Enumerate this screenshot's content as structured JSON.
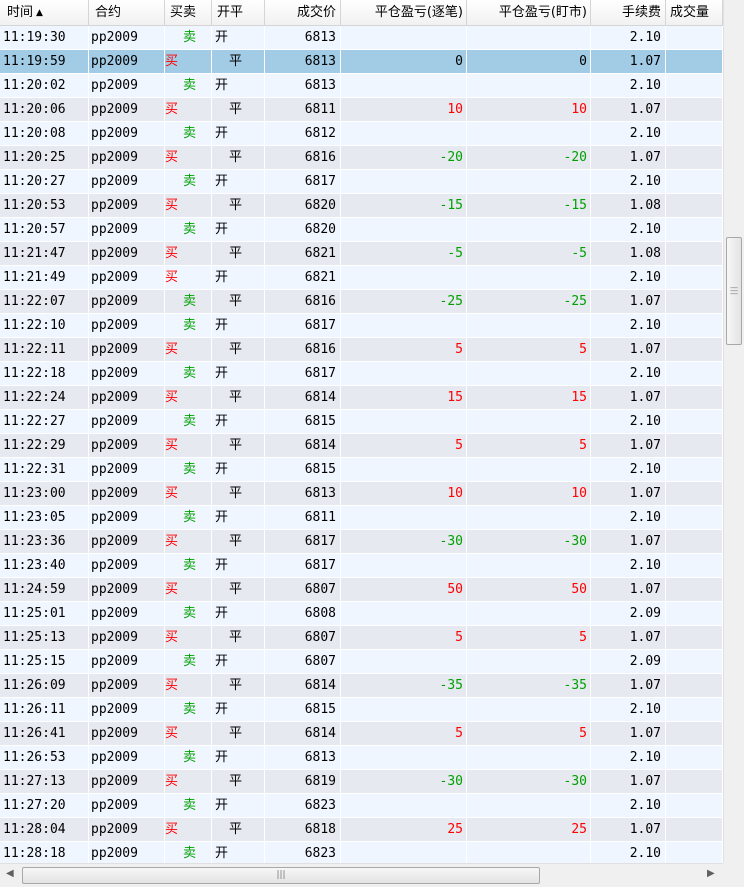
{
  "columns": [
    {
      "label": "时间",
      "sort": "▲"
    },
    {
      "label": "合约"
    },
    {
      "label": "买卖"
    },
    {
      "label": "开平"
    },
    {
      "label": "成交价"
    },
    {
      "label": "平仓盈亏(逐笔)"
    },
    {
      "label": "平仓盈亏(盯市)"
    },
    {
      "label": "手续费"
    },
    {
      "label": "成交量"
    }
  ],
  "selected_row": 1,
  "colors": {
    "buy": "#ff0000",
    "sell": "#00a000",
    "profit": "#ff0000",
    "loss": "#00a000",
    "selection": "#a2cbe6"
  },
  "icons": {
    "sort": "sort-ascending-icon",
    "scroll_left": "arrow-left-icon",
    "scroll_right": "arrow-right-icon"
  },
  "rows": [
    {
      "time": "11:19:30",
      "contract": "pp2009",
      "side": "卖",
      "oc": "开",
      "price": "6813",
      "pnl_trade": "",
      "pnl_mark": "",
      "fee": "2.10"
    },
    {
      "time": "11:19:59",
      "contract": "pp2009",
      "side": "买",
      "oc": "平",
      "price": "6813",
      "pnl_trade": "0",
      "pnl_mark": "0",
      "fee": "1.07"
    },
    {
      "time": "11:20:02",
      "contract": "pp2009",
      "side": "卖",
      "oc": "开",
      "price": "6813",
      "pnl_trade": "",
      "pnl_mark": "",
      "fee": "2.10"
    },
    {
      "time": "11:20:06",
      "contract": "pp2009",
      "side": "买",
      "oc": "平",
      "price": "6811",
      "pnl_trade": "10",
      "pnl_mark": "10",
      "fee": "1.07"
    },
    {
      "time": "11:20:08",
      "contract": "pp2009",
      "side": "卖",
      "oc": "开",
      "price": "6812",
      "pnl_trade": "",
      "pnl_mark": "",
      "fee": "2.10"
    },
    {
      "time": "11:20:25",
      "contract": "pp2009",
      "side": "买",
      "oc": "平",
      "price": "6816",
      "pnl_trade": "-20",
      "pnl_mark": "-20",
      "fee": "1.07"
    },
    {
      "time": "11:20:27",
      "contract": "pp2009",
      "side": "卖",
      "oc": "开",
      "price": "6817",
      "pnl_trade": "",
      "pnl_mark": "",
      "fee": "2.10"
    },
    {
      "time": "11:20:53",
      "contract": "pp2009",
      "side": "买",
      "oc": "平",
      "price": "6820",
      "pnl_trade": "-15",
      "pnl_mark": "-15",
      "fee": "1.08"
    },
    {
      "time": "11:20:57",
      "contract": "pp2009",
      "side": "卖",
      "oc": "开",
      "price": "6820",
      "pnl_trade": "",
      "pnl_mark": "",
      "fee": "2.10"
    },
    {
      "time": "11:21:47",
      "contract": "pp2009",
      "side": "买",
      "oc": "平",
      "price": "6821",
      "pnl_trade": "-5",
      "pnl_mark": "-5",
      "fee": "1.08"
    },
    {
      "time": "11:21:49",
      "contract": "pp2009",
      "side": "买",
      "oc": "开",
      "price": "6821",
      "pnl_trade": "",
      "pnl_mark": "",
      "fee": "2.10"
    },
    {
      "time": "11:22:07",
      "contract": "pp2009",
      "side": "卖",
      "oc": "平",
      "price": "6816",
      "pnl_trade": "-25",
      "pnl_mark": "-25",
      "fee": "1.07"
    },
    {
      "time": "11:22:10",
      "contract": "pp2009",
      "side": "卖",
      "oc": "开",
      "price": "6817",
      "pnl_trade": "",
      "pnl_mark": "",
      "fee": "2.10"
    },
    {
      "time": "11:22:11",
      "contract": "pp2009",
      "side": "买",
      "oc": "平",
      "price": "6816",
      "pnl_trade": "5",
      "pnl_mark": "5",
      "fee": "1.07"
    },
    {
      "time": "11:22:18",
      "contract": "pp2009",
      "side": "卖",
      "oc": "开",
      "price": "6817",
      "pnl_trade": "",
      "pnl_mark": "",
      "fee": "2.10"
    },
    {
      "time": "11:22:24",
      "contract": "pp2009",
      "side": "买",
      "oc": "平",
      "price": "6814",
      "pnl_trade": "15",
      "pnl_mark": "15",
      "fee": "1.07"
    },
    {
      "time": "11:22:27",
      "contract": "pp2009",
      "side": "卖",
      "oc": "开",
      "price": "6815",
      "pnl_trade": "",
      "pnl_mark": "",
      "fee": "2.10"
    },
    {
      "time": "11:22:29",
      "contract": "pp2009",
      "side": "买",
      "oc": "平",
      "price": "6814",
      "pnl_trade": "5",
      "pnl_mark": "5",
      "fee": "1.07"
    },
    {
      "time": "11:22:31",
      "contract": "pp2009",
      "side": "卖",
      "oc": "开",
      "price": "6815",
      "pnl_trade": "",
      "pnl_mark": "",
      "fee": "2.10"
    },
    {
      "time": "11:23:00",
      "contract": "pp2009",
      "side": "买",
      "oc": "平",
      "price": "6813",
      "pnl_trade": "10",
      "pnl_mark": "10",
      "fee": "1.07"
    },
    {
      "time": "11:23:05",
      "contract": "pp2009",
      "side": "卖",
      "oc": "开",
      "price": "6811",
      "pnl_trade": "",
      "pnl_mark": "",
      "fee": "2.10"
    },
    {
      "time": "11:23:36",
      "contract": "pp2009",
      "side": "买",
      "oc": "平",
      "price": "6817",
      "pnl_trade": "-30",
      "pnl_mark": "-30",
      "fee": "1.07"
    },
    {
      "time": "11:23:40",
      "contract": "pp2009",
      "side": "卖",
      "oc": "开",
      "price": "6817",
      "pnl_trade": "",
      "pnl_mark": "",
      "fee": "2.10"
    },
    {
      "time": "11:24:59",
      "contract": "pp2009",
      "side": "买",
      "oc": "平",
      "price": "6807",
      "pnl_trade": "50",
      "pnl_mark": "50",
      "fee": "1.07"
    },
    {
      "time": "11:25:01",
      "contract": "pp2009",
      "side": "卖",
      "oc": "开",
      "price": "6808",
      "pnl_trade": "",
      "pnl_mark": "",
      "fee": "2.09"
    },
    {
      "time": "11:25:13",
      "contract": "pp2009",
      "side": "买",
      "oc": "平",
      "price": "6807",
      "pnl_trade": "5",
      "pnl_mark": "5",
      "fee": "1.07"
    },
    {
      "time": "11:25:15",
      "contract": "pp2009",
      "side": "卖",
      "oc": "开",
      "price": "6807",
      "pnl_trade": "",
      "pnl_mark": "",
      "fee": "2.09"
    },
    {
      "time": "11:26:09",
      "contract": "pp2009",
      "side": "买",
      "oc": "平",
      "price": "6814",
      "pnl_trade": "-35",
      "pnl_mark": "-35",
      "fee": "1.07"
    },
    {
      "time": "11:26:11",
      "contract": "pp2009",
      "side": "卖",
      "oc": "开",
      "price": "6815",
      "pnl_trade": "",
      "pnl_mark": "",
      "fee": "2.10"
    },
    {
      "time": "11:26:41",
      "contract": "pp2009",
      "side": "买",
      "oc": "平",
      "price": "6814",
      "pnl_trade": "5",
      "pnl_mark": "5",
      "fee": "1.07"
    },
    {
      "time": "11:26:53",
      "contract": "pp2009",
      "side": "卖",
      "oc": "开",
      "price": "6813",
      "pnl_trade": "",
      "pnl_mark": "",
      "fee": "2.10"
    },
    {
      "time": "11:27:13",
      "contract": "pp2009",
      "side": "买",
      "oc": "平",
      "price": "6819",
      "pnl_trade": "-30",
      "pnl_mark": "-30",
      "fee": "1.07"
    },
    {
      "time": "11:27:20",
      "contract": "pp2009",
      "side": "卖",
      "oc": "开",
      "price": "6823",
      "pnl_trade": "",
      "pnl_mark": "",
      "fee": "2.10"
    },
    {
      "time": "11:28:04",
      "contract": "pp2009",
      "side": "买",
      "oc": "平",
      "price": "6818",
      "pnl_trade": "25",
      "pnl_mark": "25",
      "fee": "1.07"
    },
    {
      "time": "11:28:18",
      "contract": "pp2009",
      "side": "卖",
      "oc": "开",
      "price": "6823",
      "pnl_trade": "",
      "pnl_mark": "",
      "fee": "2.10"
    }
  ]
}
